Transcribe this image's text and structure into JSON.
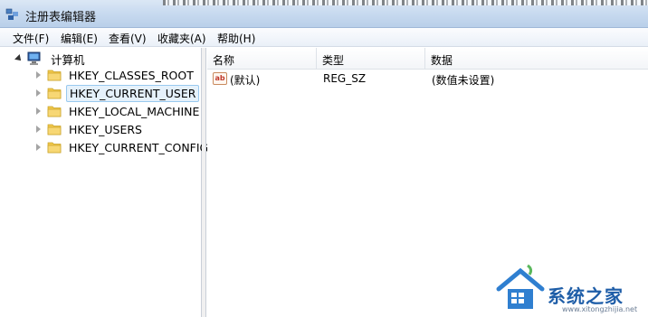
{
  "window": {
    "title": "注册表编辑器"
  },
  "menu": [
    {
      "label": "文件(F)"
    },
    {
      "label": "编辑(E)"
    },
    {
      "label": "查看(V)"
    },
    {
      "label": "收藏夹(A)"
    },
    {
      "label": "帮助(H)"
    }
  ],
  "tree": {
    "root_label": "计算机",
    "items": [
      {
        "label": "HKEY_CLASSES_ROOT",
        "selected": false
      },
      {
        "label": "HKEY_CURRENT_USER",
        "selected": true
      },
      {
        "label": "HKEY_LOCAL_MACHINE",
        "selected": false
      },
      {
        "label": "HKEY_USERS",
        "selected": false
      },
      {
        "label": "HKEY_CURRENT_CONFIG",
        "selected": false
      }
    ]
  },
  "list": {
    "columns": [
      "名称",
      "类型",
      "数据"
    ],
    "rows": [
      {
        "name": "(默认)",
        "type": "REG_SZ",
        "data": "(数值未设置)",
        "icon": "string-value-icon"
      }
    ]
  },
  "watermark": {
    "text": "系统之家",
    "url": "www.xitongzhijia.net"
  },
  "colors": {
    "selection_bg": "#e5f1fb",
    "selection_border": "#99c9ef",
    "folder": "#f2c94c"
  }
}
